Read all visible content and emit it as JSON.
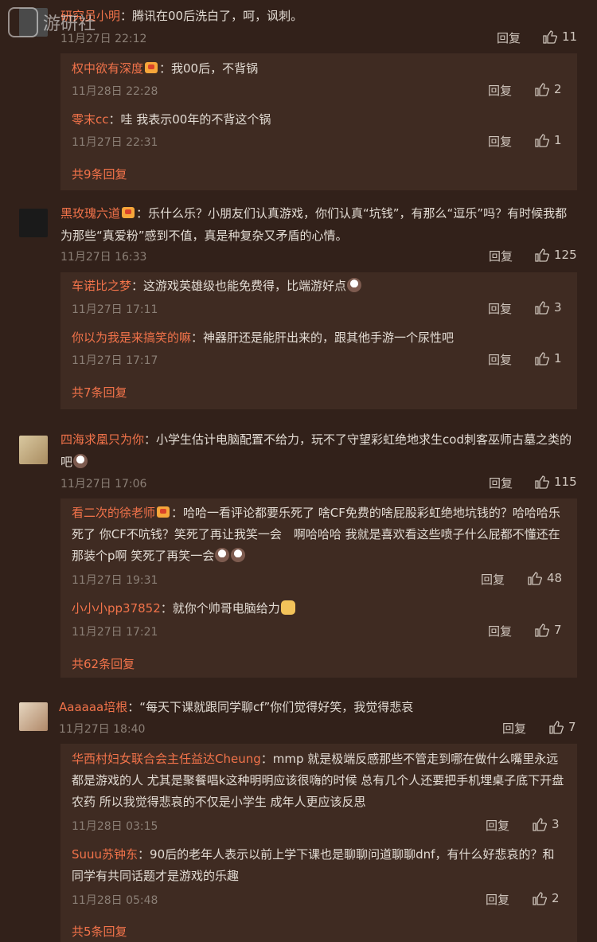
{
  "watermark": {
    "text": "游研社"
  },
  "actions": {
    "reply_label": "回复"
  },
  "comments": [
    {
      "username": "研究员小明",
      "text": "：腾讯在00后洗白了，呵，讽刺。",
      "time": "11月27日 22:12",
      "likes": "11",
      "replies": [
        {
          "username": "权中欲有深度",
          "text": "：我00后，不背锅",
          "time": "11月28日 22:28",
          "likes": "2"
        },
        {
          "username": "零末cc",
          "text": "：哇 我表示00年的不背这个锅",
          "time": "11月27日 22:31",
          "likes": "1"
        }
      ],
      "more": "共9条回复"
    },
    {
      "username": "黑玫瑰六道",
      "text": "：乐什么乐？小朋友们认真游戏，你们认真“坑钱”，有那么“逗乐”吗？有时候我都为那些“真爱粉”感到不值，真是种复杂又矛盾的心情。",
      "time": "11月27日 16:33",
      "likes": "125",
      "replies": [
        {
          "username": "车诺比之梦",
          "text": "：这游戏英雄级也能免费得，比端游好点",
          "time": "11月27日 17:11",
          "likes": "3"
        },
        {
          "username": "你以为我是来搞笑的嘛",
          "text": "：神器肝还是能肝出来的，跟其他手游一个尿性吧",
          "time": "11月27日 17:17",
          "likes": "1"
        }
      ],
      "more": "共7条回复"
    },
    {
      "username": "四海求凰只为你",
      "text": "：小学生估计电脑配置不给力，玩不了守望彩虹绝地求生cod刺客巫师古墓之类的吧",
      "time": "11月27日 17:06",
      "likes": "115",
      "replies": [
        {
          "username": "看二次的徐老师",
          "text": "：哈哈一看评论都要乐死了 啥CF免费的啥屁股彩虹绝地坑钱的？哈哈哈乐死了 你CF不吭钱？笑死了再让我笑一会　啊哈哈哈 我就是喜欢看这些喷子什么屁都不懂还在那装个p啊 笑死了再笑一会",
          "time": "11月27日 19:31",
          "likes": "48"
        },
        {
          "username": "小小小pp37852",
          "text": "：就你个帅哥电脑给力",
          "time": "11月27日 17:21",
          "likes": "7"
        }
      ],
      "more": "共62条回复"
    },
    {
      "username": "Aaaaaa培根",
      "text": "：“每天下课就跟同学聊cf”你们觉得好笑，我觉得悲哀",
      "time": "11月27日 18:40",
      "likes": "7",
      "replies": [
        {
          "username": "华西村妇女联合会主任益达Cheung",
          "text": "：mmp 就是极端反感那些不管走到哪在做什么嘴里永远都是游戏的人 尤其是聚餐唱k这种明明应该很嗨的时候 总有几个人还要把手机埋桌子底下开盘农药 所以我觉得悲哀的不仅是小学生 成年人更应该反思",
          "time": "11月28日 03:15",
          "likes": "3"
        },
        {
          "username": "Suuu苏钟东",
          "text": "：90后的老年人表示以前上学下课也是聊聊问道聊聊dnf，有什么好悲哀的？和同学有共同话题才是游戏的乐趣",
          "time": "11月28日 05:48",
          "likes": "2"
        }
      ],
      "more": "共5条回复"
    }
  ]
}
